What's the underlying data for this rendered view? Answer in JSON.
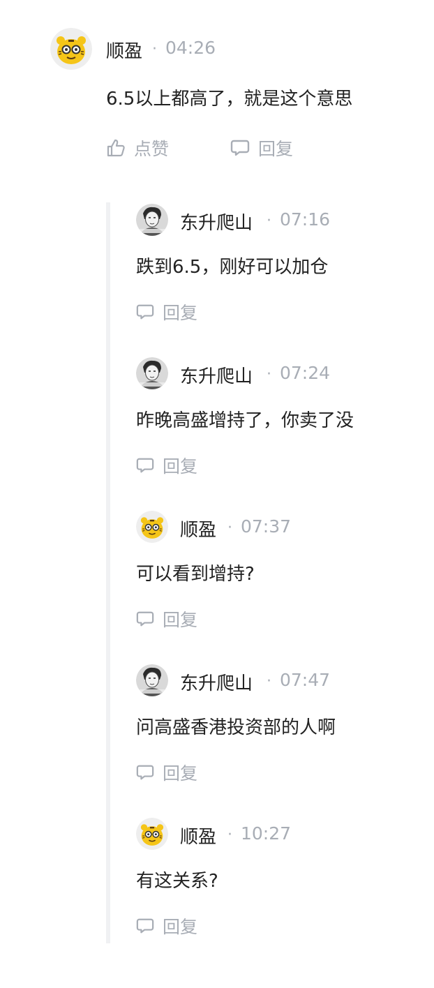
{
  "main_comment": {
    "author": "顺盈",
    "time": "04:26",
    "text": "6.5以上都高了，就是这个意思",
    "like_label": "点赞",
    "reply_label": "回复"
  },
  "replies": [
    {
      "author": "东升爬山",
      "time": "07:16",
      "text": "跌到6.5，刚好可以加仓",
      "reply_label": "回复"
    },
    {
      "author": "东升爬山",
      "time": "07:24",
      "text": "昨晚高盛增持了，你卖了没",
      "reply_label": "回复"
    },
    {
      "author": "顺盈",
      "time": "07:37",
      "text": "可以看到增持?",
      "reply_label": "回复"
    },
    {
      "author": "东升爬山",
      "time": "07:47",
      "text": "问高盛香港投资部的人啊",
      "reply_label": "回复"
    },
    {
      "author": "顺盈",
      "time": "10:27",
      "text": "有这关系?",
      "reply_label": "回复"
    }
  ],
  "separator": "·",
  "icons": {
    "tiger_avatar": "tiger-avatar-icon",
    "person_avatar": "person-avatar-icon",
    "like": "thumbs-up-icon",
    "reply": "speech-bubble-icon"
  },
  "colors": {
    "text": "#222222",
    "muted": "#a8adb5",
    "thread_line": "#f0f1f3",
    "tiger_yellow": "#f5c518"
  }
}
